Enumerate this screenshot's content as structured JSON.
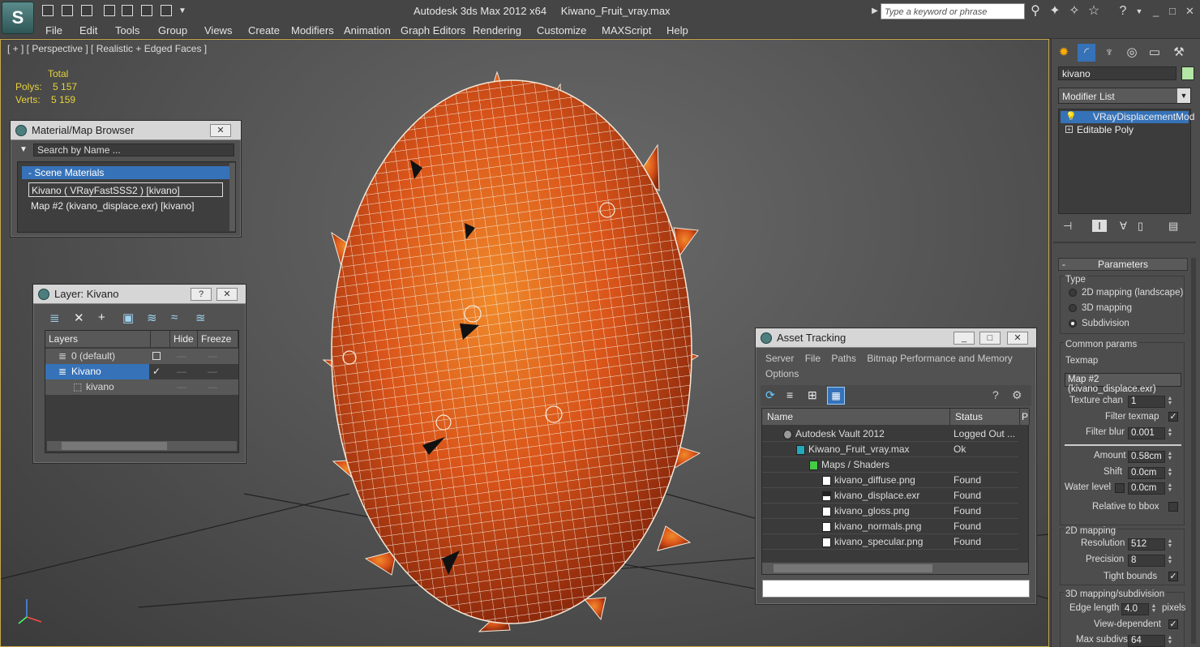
{
  "app": {
    "title_app": "Autodesk 3ds Max  2012 x64",
    "title_file": "Kiwano_Fruit_vray.max",
    "search_placeholder": "Type a keyword or phrase"
  },
  "menu": [
    "File",
    "Edit",
    "Tools",
    "Group",
    "Views",
    "Create",
    "Modifiers",
    "Animation",
    "Graph Editors",
    "Rendering",
    "Customize",
    "MAXScript",
    "Help"
  ],
  "viewport": {
    "label": "[ + ] [ Perspective ] [ Realistic + Edged Faces ]",
    "stats_header": "Total",
    "polys_label": "Polys:",
    "polys_value": "5 157",
    "verts_label": "Verts:",
    "verts_value": "5 159",
    "accent": "#c6a84d",
    "mesh_color": "#e0661e"
  },
  "material_browser": {
    "title": "Material/Map Browser",
    "search_placeholder": "Search by Name ...",
    "section": "- Scene Materials",
    "items": [
      "Kivano  ( VRayFastSSS2 )  [kivano]",
      "Map #2 (kivano_displace.exr)  [kivano]"
    ]
  },
  "layer_dialog": {
    "title": "Layer: Kivano",
    "help": "?",
    "columns": [
      "Layers",
      "Hide",
      "Freeze"
    ],
    "rows": [
      {
        "name": "0 (default)"
      },
      {
        "name": "Kivano"
      },
      {
        "name": "kivano"
      }
    ]
  },
  "asset_tracking": {
    "title": "Asset Tracking",
    "menu": [
      "Server",
      "File",
      "Paths",
      "Bitmap Performance and Memory",
      "Options"
    ],
    "columns": [
      "Name",
      "Status",
      "P"
    ],
    "rows": [
      {
        "name": "Autodesk Vault 2012",
        "status": "Logged Out ..."
      },
      {
        "name": "Kiwano_Fruit_vray.max",
        "status": "Ok"
      },
      {
        "name": "Maps / Shaders",
        "status": ""
      },
      {
        "name": "kivano_diffuse.png",
        "status": "Found"
      },
      {
        "name": "kivano_displace.exr",
        "status": "Found"
      },
      {
        "name": "kivano_gloss.png",
        "status": "Found"
      },
      {
        "name": "kivano_normals.png",
        "status": "Found"
      },
      {
        "name": "kivano_specular.png",
        "status": "Found"
      }
    ]
  },
  "command_panel": {
    "object_name": "kivano",
    "object_color": "#b4e6a5",
    "modifier_list": "Modifier List",
    "stack": [
      "VRayDisplacementMod",
      "Editable Poly"
    ],
    "rollout": "Parameters",
    "type_label": "Type",
    "type_options": [
      "2D mapping (landscape)",
      "3D mapping",
      "Subdivision"
    ],
    "common_params": "Common params",
    "texmap_label": "Texmap",
    "texmap_value": "Map #2 (kivano_displace.exr)",
    "texture_chan_label": "Texture chan",
    "texture_chan": "1",
    "filter_texmap_label": "Filter texmap",
    "filter_blur_label": "Filter blur",
    "filter_blur": "0.001",
    "amount_label": "Amount",
    "amount": "0.58cm",
    "shift_label": "Shift",
    "shift": "0.0cm",
    "water_level_label": "Water level",
    "water_level": "0.0cm",
    "relative_bbox_label": "Relative to bbox",
    "mapping_2d": "2D mapping",
    "resolution_label": "Resolution",
    "resolution": "512",
    "precision_label": "Precision",
    "precision": "8",
    "tight_bounds_label": "Tight bounds",
    "mapping_3d": "3D mapping/subdivision",
    "edge_length_label": "Edge length",
    "edge_length": "4.0",
    "pixels_label": "pixels",
    "view_dependent_label": "View-dependent",
    "max_subdivs_label": "Max subdivs",
    "max_subdivs": "64"
  }
}
